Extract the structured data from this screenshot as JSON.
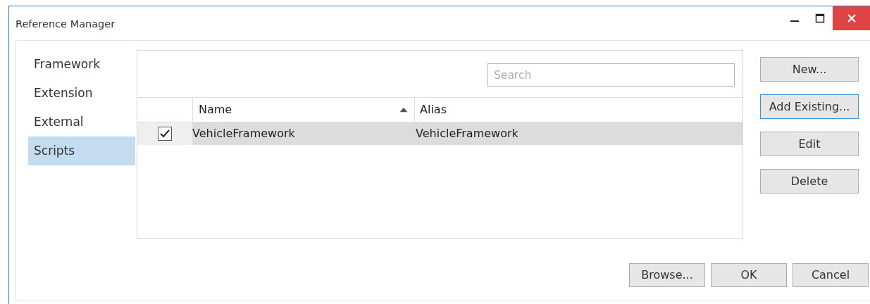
{
  "window": {
    "title": "Reference Manager"
  },
  "sidebar": {
    "items": [
      {
        "label": "Framework",
        "selected": false
      },
      {
        "label": "Extension",
        "selected": false
      },
      {
        "label": "External",
        "selected": false
      },
      {
        "label": "Scripts",
        "selected": true
      }
    ]
  },
  "search": {
    "placeholder": "Search"
  },
  "table": {
    "columns": [
      {
        "label": "Name",
        "sorted_ascending": true
      },
      {
        "label": "Alias",
        "sorted_ascending": false
      }
    ],
    "rows": [
      {
        "checked": true,
        "selected": true,
        "name": "VehicleFramework",
        "alias": "VehicleFramework"
      }
    ]
  },
  "side_buttons": [
    {
      "label": "New...",
      "focused": false
    },
    {
      "label": "Add Existing...",
      "focused": true
    },
    {
      "label": "Edit",
      "focused": false
    },
    {
      "label": "Delete",
      "focused": false
    }
  ],
  "footer_buttons": [
    "Browse...",
    "OK",
    "Cancel"
  ]
}
